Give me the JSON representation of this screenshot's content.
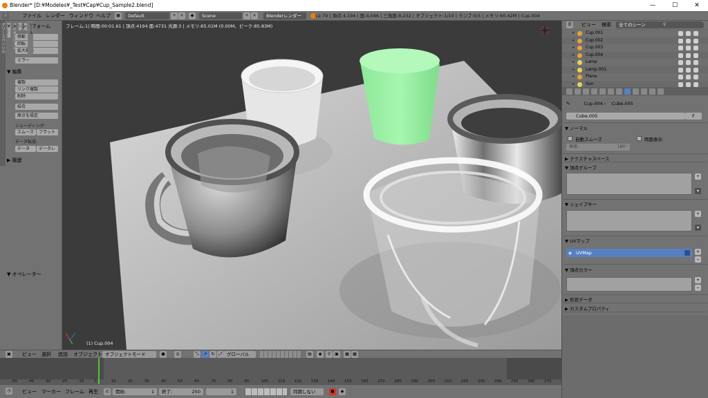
{
  "window": {
    "title": "Blender* [D:¥Modeles¥_Test¥Cap¥Cup_Sample2.blend]",
    "minimize": "—",
    "maximize": "☐",
    "close": "✕"
  },
  "topbar": {
    "menus": [
      "ファイル",
      "レンダー",
      "ウィンドウ",
      "ヘルプ"
    ],
    "screen_layout": "Default",
    "scene": "Scene",
    "render_engine": "Blenderレンダー",
    "stats": "v2.79 | 頂点:4,194 | 面:4,046 | 三角面:8,232 | オブジェクト:1/10 | ランプ:0/3 | メモリ:60.42M | Cup.004"
  },
  "toolshelf": {
    "tabs": [
      "ツール",
      "作成",
      "関係",
      "アニメーション",
      "物理演算",
      "グリースペンシル"
    ],
    "transform_header": "トランスフォーム",
    "move": "移動",
    "rotate": "回転",
    "scale": "拡大縮小",
    "mirror": "ミラー",
    "edit_header": "編集",
    "duplicate": "複製",
    "link_duplicate": "リンク複製",
    "delete": "削除",
    "join": "結合",
    "set_origin": "原点を設定",
    "shading_label": "シェーディング:",
    "smooth": "スムーズ",
    "flat": "フラット",
    "data_transfer_label": "データ転送:",
    "data": "データ",
    "data_layers": "データレ",
    "history_header": "履歴",
    "operator_header": "オペレーター"
  },
  "viewport": {
    "info": "フレーム:1| 時間:00:01.61 | 頂点:4194 面:4731 光源:3 | メモリ:65.01M (0.00M、ピーク:85.83M)",
    "object_label": "(1) Cup.004"
  },
  "view3d_header": {
    "view": "ビュー",
    "select": "選択",
    "add": "追加",
    "object": "オブジェクト",
    "mode": "オブジェクトモード",
    "orientation": "グローバル"
  },
  "timeline": {
    "ticks": [
      "-50",
      "-40",
      "-30",
      "-20",
      "-10",
      "0",
      "10",
      "20",
      "30",
      "40",
      "50",
      "60",
      "70",
      "80",
      "90",
      "100",
      "110",
      "120",
      "130",
      "140",
      "150",
      "160",
      "170",
      "180",
      "190",
      "200",
      "210",
      "220",
      "230",
      "240",
      "250",
      "260",
      "270",
      "280"
    ],
    "view": "ビュー",
    "marker": "マーカー",
    "frame": "フレーム",
    "playback": "再生",
    "start_label": "開始:",
    "start_value": "1",
    "end_label": "終了:",
    "end_value": "250",
    "current_frame": "1",
    "sync": "同期しない"
  },
  "outliner": {
    "view": "ビュー",
    "search": "検索",
    "scenes": "全てのシーン",
    "items": [
      {
        "name": "Cup.001",
        "type": "mesh"
      },
      {
        "name": "Cup.002",
        "type": "mesh"
      },
      {
        "name": "Cup.003",
        "type": "mesh"
      },
      {
        "name": "Cup.004",
        "type": "mesh"
      },
      {
        "name": "Lamp",
        "type": "lamp"
      },
      {
        "name": "Lamp.001",
        "type": "lamp"
      },
      {
        "name": "Plane",
        "type": "mesh"
      },
      {
        "name": "Sun",
        "type": "lamp"
      }
    ]
  },
  "properties": {
    "breadcrumb_object": "Cup.004",
    "breadcrumb_mesh": "Cube.005",
    "mesh_name": "Cube.005",
    "fake_user": "F",
    "normals_header": "ノーマル",
    "auto_smooth": "自動スムーズ",
    "double_sided": "両面表示",
    "angle_label": "角度:",
    "angle_value": "180°",
    "texture_space": "テクスチャスペース",
    "vertex_groups": "頂点グループ",
    "shape_keys": "シェイプキー",
    "uv_maps": "UVマップ",
    "uv_map_item": "UVMap",
    "vertex_colors": "頂点カラー",
    "geometry_data": "形状データ",
    "custom_props": "カスタムプロパティ"
  },
  "colors": {
    "accent_blue": "#5680c2",
    "timeline_cursor": "#57c23c",
    "selected_orange": "#e8a23a"
  }
}
